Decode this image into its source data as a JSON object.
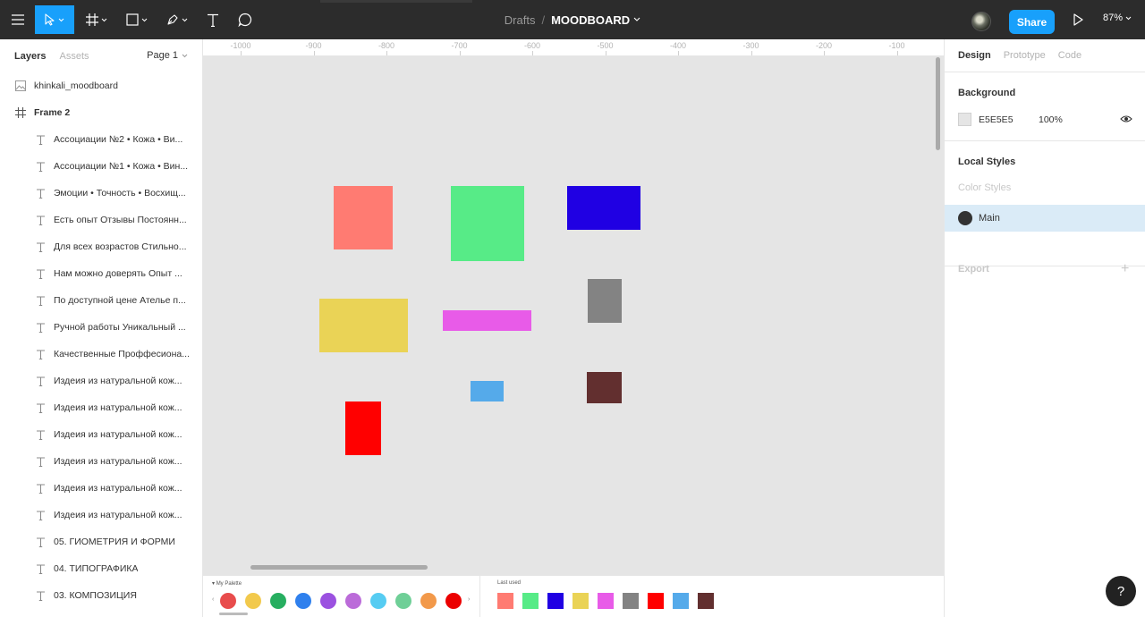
{
  "topbar": {
    "breadcrumb_root": "Drafts",
    "separator": "/",
    "file_name": "MOODBOARD",
    "share_label": "Share",
    "zoom": "87%",
    "accent": "#18a0fb",
    "tools": [
      "menu-icon",
      "move-tool-icon",
      "frame-tool-icon",
      "shape-tool-icon",
      "pen-tool-icon",
      "text-tool-icon",
      "comment-tool-icon"
    ]
  },
  "left_panel": {
    "tabs": [
      "Layers",
      "Assets"
    ],
    "page": "Page 1",
    "layers": [
      {
        "label": "khinkali_moodboard",
        "icon": "image",
        "level": 0,
        "bold": false
      },
      {
        "label": "Frame 2",
        "icon": "frame",
        "level": 0,
        "bold": true
      },
      {
        "label": "Ассоциации №2 • Кожа • Ви...",
        "icon": "text",
        "level": 1,
        "bold": false
      },
      {
        "label": "Ассоциации №1 • Кожа • Вин...",
        "icon": "text",
        "level": 1,
        "bold": false
      },
      {
        "label": "Эмоции • Точность • Восхищ...",
        "icon": "text",
        "level": 1,
        "bold": false
      },
      {
        "label": "Есть опыт Отзывы Постоянн...",
        "icon": "text",
        "level": 1,
        "bold": false
      },
      {
        "label": "Для всех возрастов Стильно...",
        "icon": "text",
        "level": 1,
        "bold": false
      },
      {
        "label": "Нам можно доверять Опыт ...",
        "icon": "text",
        "level": 1,
        "bold": false
      },
      {
        "label": "По доступной цене Ателье п...",
        "icon": "text",
        "level": 1,
        "bold": false
      },
      {
        "label": "Ручной работы Уникальный ...",
        "icon": "text",
        "level": 1,
        "bold": false
      },
      {
        "label": "Качественные Проффесиона...",
        "icon": "text",
        "level": 1,
        "bold": false
      },
      {
        "label": "Издеия из натуральной кож...",
        "icon": "text",
        "level": 1,
        "bold": false
      },
      {
        "label": "Издеия из натуральной кож...",
        "icon": "text",
        "level": 1,
        "bold": false
      },
      {
        "label": "Издеия из натуральной кож...",
        "icon": "text",
        "level": 1,
        "bold": false
      },
      {
        "label": "Издеия из натуральной кож...",
        "icon": "text",
        "level": 1,
        "bold": false
      },
      {
        "label": "Издеия из натуральной кож...",
        "icon": "text",
        "level": 1,
        "bold": false
      },
      {
        "label": "Издеия из натуральной кож...",
        "icon": "text",
        "level": 1,
        "bold": false
      },
      {
        "label": "05. ГИОМЕТРИЯ И ФОРМИ",
        "icon": "text",
        "level": 1,
        "bold": false
      },
      {
        "label": "04. ТИПОГРАФИКА",
        "icon": "text",
        "level": 1,
        "bold": false
      },
      {
        "label": "03. КОМПОЗИЦИЯ",
        "icon": "text",
        "level": 1,
        "bold": false
      }
    ]
  },
  "ruler": {
    "labels": [
      "-1000",
      "-900",
      "-800",
      "-700",
      "-600",
      "-500",
      "-400",
      "-300",
      "-200",
      "-100"
    ]
  },
  "canvas": {
    "background": "#e5e5e5",
    "shapes": [
      {
        "name": "salmon-rectangle",
        "color": "#ff7b72"
      },
      {
        "name": "green-rectangle",
        "color": "#57eb87"
      },
      {
        "name": "blue-rectangle",
        "color": "#2000e3"
      },
      {
        "name": "yellow-rectangle",
        "color": "#ead356"
      },
      {
        "name": "magenta-rectangle",
        "color": "#e85be8"
      },
      {
        "name": "gray-rectangle",
        "color": "#838383"
      },
      {
        "name": "light-blue-rectangle",
        "color": "#55aaea"
      },
      {
        "name": "maroon-rectangle",
        "color": "#622f2f"
      },
      {
        "name": "red-rectangle",
        "color": "#ff0000"
      }
    ]
  },
  "palette": {
    "my_palette_title": "My Palette",
    "my_palette": [
      "#e84c4c",
      "#f2c94c",
      "#27ae60",
      "#2f80ed",
      "#9b51e0",
      "#bb6bd9",
      "#56ccf2",
      "#6fcf97",
      "#f2994a",
      "#eb0000"
    ],
    "last_used_title": "Last used",
    "last_used": [
      "#ff7b72",
      "#57eb87",
      "#2000e3",
      "#ead356",
      "#e85be8",
      "#838383",
      "#ff0000",
      "#55aaea",
      "#622f2f"
    ]
  },
  "right_panel": {
    "tabs": [
      "Design",
      "Prototype",
      "Code"
    ],
    "background_title": "Background",
    "bg_hex": "E5E5E5",
    "bg_opacity": "100%",
    "local_styles_title": "Local Styles",
    "color_styles_label": "Color Styles",
    "style_name": "Main",
    "export_title": "Export"
  },
  "help_label": "?"
}
